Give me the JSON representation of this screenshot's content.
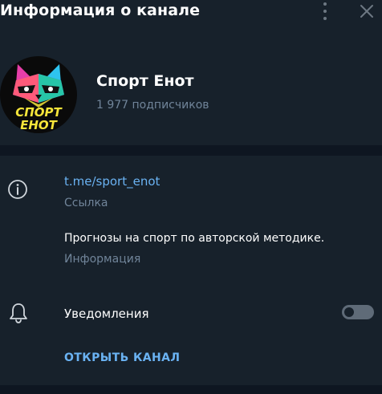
{
  "header": {
    "title": "Информация о канале",
    "menu_icon": "more-vertical-icon",
    "close_icon": "close-icon"
  },
  "channel": {
    "name": "Спорт Енот",
    "subscribers": "1 977 подписчиков",
    "avatar": {
      "line1": "СПОРТ",
      "line2": "ЕНОТ"
    }
  },
  "info": {
    "link": "t.me/sport_enot",
    "link_caption": "Ссылка",
    "description": "Прогнозы на спорт по авторской методике.",
    "description_caption": "Информация"
  },
  "notifications": {
    "label": "Уведомления",
    "enabled": false
  },
  "actions": {
    "open_channel": "ОТКРЫТЬ КАНАЛ"
  },
  "colors": {
    "background": "#17212b",
    "divider": "#0e1621",
    "accent": "#6ab2f2",
    "muted_text": "#708499"
  }
}
